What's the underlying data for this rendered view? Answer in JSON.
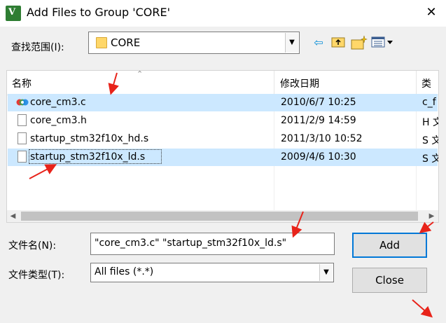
{
  "window": {
    "title": "Add Files to Group 'CORE'",
    "app_icon_glyph": "V",
    "close_glyph": "✕"
  },
  "lookin": {
    "label": "查找范围(I):",
    "value": "CORE"
  },
  "toolbar_icons": [
    "back-arrow-icon",
    "up-folder-icon",
    "new-folder-icon",
    "view-menu-icon"
  ],
  "list": {
    "headers": {
      "name": "名称",
      "date": "修改日期",
      "type": "类"
    },
    "rows": [
      {
        "name": "core_cm3.c",
        "date": "2010/6/7 10:25",
        "type": "c_f",
        "icon": "c-source-icon",
        "selected": true
      },
      {
        "name": "core_cm3.h",
        "date": "2011/2/9 14:59",
        "type": "H 文",
        "icon": "file-icon",
        "selected": false
      },
      {
        "name": "startup_stm32f10x_hd.s",
        "date": "2011/3/10 10:52",
        "type": "S 文",
        "icon": "file-icon",
        "selected": false
      },
      {
        "name": "startup_stm32f10x_ld.s",
        "date": "2009/4/6 10:30",
        "type": "S 文",
        "icon": "file-icon",
        "selected": true
      }
    ]
  },
  "filename": {
    "label": "文件名(N):",
    "value": "\"core_cm3.c\" \"startup_stm32f10x_ld.s\""
  },
  "filetype": {
    "label": "文件类型(T):",
    "value": "All files (*.*)"
  },
  "buttons": {
    "add": "Add",
    "close": "Close"
  },
  "colors": {
    "selection": "#cce8ff",
    "annotation_arrow": "#e8231a",
    "default_button_border": "#0078d7"
  }
}
